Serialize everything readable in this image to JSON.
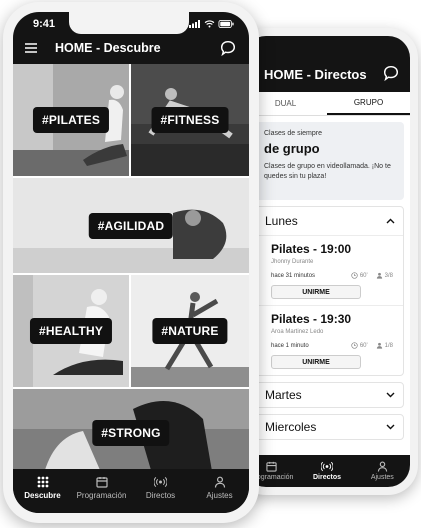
{
  "back_phone": {
    "header_title": "HOME - Directos",
    "tabs": [
      {
        "label": "DUAL",
        "active": false
      },
      {
        "label": "GRUPO",
        "active": true
      }
    ],
    "info_card": {
      "kicker": "Clases de siempre",
      "title": "de grupo",
      "description": "Clases de grupo en videollamada. ¡No te quedes sin tu plaza!"
    },
    "days": {
      "open": {
        "name": "Lunes",
        "classes": [
          {
            "title": "Pilates - 19:00",
            "teacher": "Jhonny Durante",
            "posted": "hace 31 minutos",
            "duration": "60'",
            "spots": "3/8",
            "button": "UNIRME"
          },
          {
            "title": "Pilates - 19:30",
            "teacher": "Aroa Martinez Ledo",
            "posted": "hace 1 minuto",
            "duration": "60'",
            "spots": "1/8",
            "button": "UNIRME"
          }
        ]
      },
      "collapsed": [
        "Martes",
        "Miercoles"
      ]
    },
    "bottom_nav": [
      {
        "label": "Programación",
        "icon": "calendar-icon",
        "active": false
      },
      {
        "label": "Directos",
        "icon": "broadcast-icon",
        "active": true
      },
      {
        "label": "Ajustes",
        "icon": "user-icon",
        "active": false
      }
    ]
  },
  "front_phone": {
    "status_time": "9:41",
    "header_title": "HOME - Descubre",
    "tiles": [
      {
        "tag": "#PILATES"
      },
      {
        "tag": "#FITNESS"
      },
      {
        "tag": "#AGILIDAD"
      },
      {
        "tag": "#HEALTHY"
      },
      {
        "tag": "#NATURE"
      },
      {
        "tag": "#STRONG"
      }
    ],
    "bottom_nav": [
      {
        "label": "Descubre",
        "icon": "grid-icon",
        "active": true
      },
      {
        "label": "Programación",
        "icon": "calendar-icon",
        "active": false
      },
      {
        "label": "Directos",
        "icon": "broadcast-icon",
        "active": false
      },
      {
        "label": "Ajustes",
        "icon": "user-icon",
        "active": false
      }
    ]
  },
  "colors": {
    "dark": "#141414",
    "card_bg": "#eef0f3",
    "frame": "#f3f3f3"
  }
}
